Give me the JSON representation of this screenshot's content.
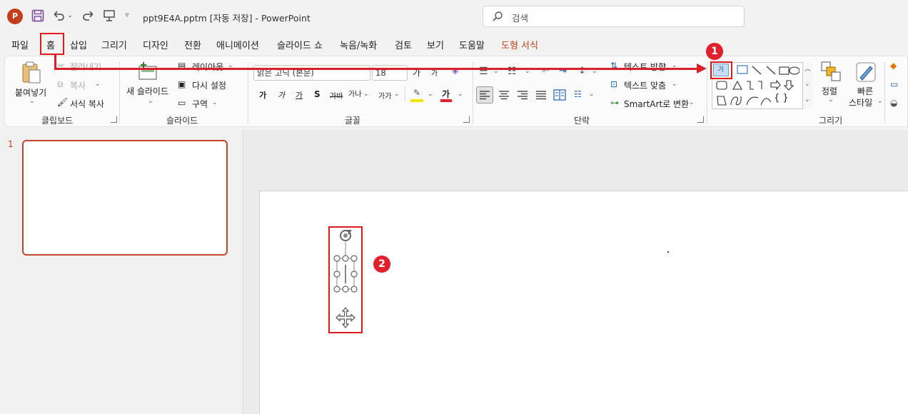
{
  "titlebar": {
    "logo_letter": "P",
    "title": "ppt9E4A.pptm [자동 저장]  -  PowerPoint",
    "search_placeholder": "검색"
  },
  "tabs": [
    {
      "label": "파일"
    },
    {
      "label": "홈"
    },
    {
      "label": "삽입"
    },
    {
      "label": "그리기"
    },
    {
      "label": "디자인"
    },
    {
      "label": "전환"
    },
    {
      "label": "애니메이션"
    },
    {
      "label": "슬라이드 쇼"
    },
    {
      "label": "녹음/녹화"
    },
    {
      "label": "검토"
    },
    {
      "label": "보기"
    },
    {
      "label": "도움말"
    },
    {
      "label": "도형 서식"
    }
  ],
  "ribbon": {
    "clipboard": {
      "paste": "붙여넣기",
      "cut": "잘라내기",
      "copy": "복사",
      "format_painter": "서식 복사",
      "label": "클립보드"
    },
    "slides": {
      "new_slide": "새 슬라이드",
      "layout": "레이아웃",
      "reset": "다시 설정",
      "section": "구역",
      "label": "슬라이드"
    },
    "font": {
      "font_name": "맑은 고딕 (본문)",
      "font_size": "18",
      "increase": "가",
      "decrease": "가",
      "bold": "가",
      "italic": "가",
      "underline": "가",
      "shadow": "S",
      "strike": "가바",
      "spacing": "가나",
      "case": "가가",
      "font_color_glyph": "가",
      "label": "글꼴"
    },
    "paragraph": {
      "text_direction": "텍스트 방향",
      "align_text": "텍스트 맞춤",
      "smartart": "SmartArt로 변환",
      "label": "단락"
    },
    "drawing": {
      "textbox_glyph": "가",
      "arrange": "정렬",
      "quick_styles_1": "빠른",
      "quick_styles_2": "스타일",
      "label": "그리기",
      "braces": "{ }"
    }
  },
  "slides_panel": {
    "slide_number": "1"
  },
  "annotations": {
    "badge1": "1",
    "badge2": "2",
    "color": "#e01b1b"
  }
}
